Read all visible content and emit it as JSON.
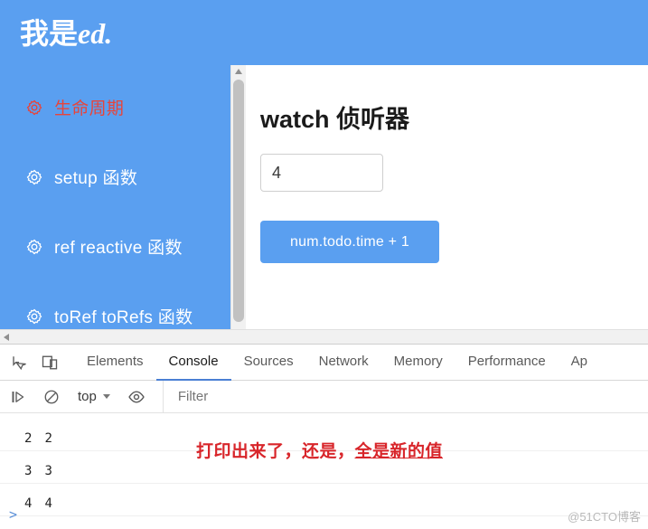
{
  "banner": {
    "title_plain": "我是",
    "title_italic": "ed."
  },
  "sidebar": {
    "items": [
      {
        "label": "生命周期",
        "icon": "gear-icon",
        "active": true
      },
      {
        "label": "setup 函数",
        "icon": "gear-icon",
        "active": false
      },
      {
        "label": "ref reactive 函数",
        "icon": "gear-icon",
        "active": false
      },
      {
        "label": "toRef toRefs 函数",
        "icon": "gear-icon",
        "active": false
      }
    ]
  },
  "content": {
    "title": "watch 侦听器",
    "input_value": "4",
    "input_placeholder": "",
    "button_label": "num.todo.time + 1"
  },
  "devtools": {
    "icons": {
      "inspect": "inspect-element-icon",
      "device": "device-toolbar-icon"
    },
    "tabs": [
      {
        "label": "Elements",
        "selected": false
      },
      {
        "label": "Console",
        "selected": true
      },
      {
        "label": "Sources",
        "selected": false
      },
      {
        "label": "Network",
        "selected": false
      },
      {
        "label": "Memory",
        "selected": false
      },
      {
        "label": "Performance",
        "selected": false
      },
      {
        "label": "Ap",
        "selected": false
      }
    ],
    "toolbar": {
      "execute_icon": "execute-step-icon",
      "clear_icon": "clear-console-icon",
      "context_label": "top",
      "eye_icon": "live-expression-eye-icon",
      "filter_placeholder": "Filter",
      "filter_value": ""
    },
    "console_rows": [
      {
        "count": "2",
        "message": "2"
      },
      {
        "count": "3",
        "message": "3"
      },
      {
        "count": "4",
        "message": "4"
      }
    ],
    "prompt": ">"
  },
  "annotation": {
    "text_start": "打印出来了，还是，",
    "text_underlined": "全是新的值"
  },
  "watermark": "@51CTO博客",
  "colors": {
    "brand_blue": "#5a9ff0",
    "active_red": "#e8443a",
    "annotation_red": "#d8252a",
    "tab_accent": "#4a7fd4"
  }
}
